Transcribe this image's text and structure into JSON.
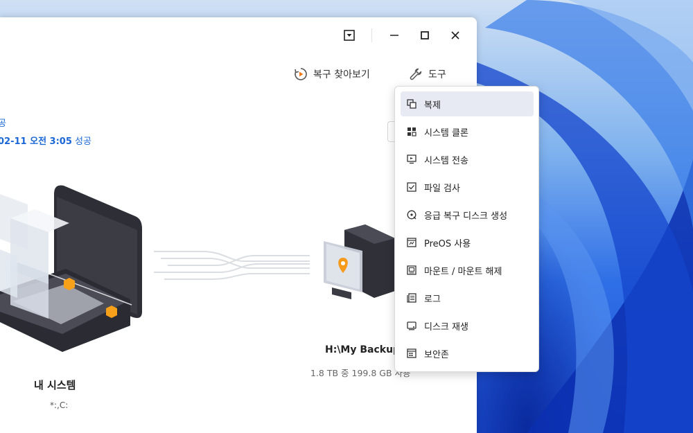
{
  "titlebar": {
    "dropdown_icon": "dropdown-square-icon",
    "minimize_icon": "minimize-icon",
    "maximize_icon": "maximize-icon",
    "close_icon": "close-icon"
  },
  "topnav": {
    "browse_restore_label": "복구 찾아보기",
    "tools_label": "도구"
  },
  "status": {
    "line1": "공",
    "line2_date": "02-11 오전 3:05",
    "line2_result": " 성공"
  },
  "source": {
    "name": "내 시스템",
    "sub": "*:,C:"
  },
  "destination": {
    "name": "H:\\My Backup",
    "sub": "1.8 TB 중 199.8 GB 사용"
  },
  "tools_menu": {
    "items": [
      {
        "label": "복제",
        "icon": "clone-icon"
      },
      {
        "label": "시스템 클론",
        "icon": "system-clone-icon"
      },
      {
        "label": "시스템 전송",
        "icon": "system-transfer-icon"
      },
      {
        "label": "파일 검사",
        "icon": "file-check-icon"
      },
      {
        "label": "응급 복구 디스크 생성",
        "icon": "emergency-disk-icon"
      },
      {
        "label": "PreOS 사용",
        "icon": "preos-icon"
      },
      {
        "label": "마운트 / 마운트 해제",
        "icon": "mount-icon"
      },
      {
        "label": "로그",
        "icon": "log-icon"
      },
      {
        "label": "디스크 재생",
        "icon": "disk-wipe-icon"
      },
      {
        "label": "보안존",
        "icon": "secure-zone-icon"
      }
    ]
  },
  "colors": {
    "accent": "#1a66d6",
    "menu_highlight": "#e7eaf2"
  }
}
